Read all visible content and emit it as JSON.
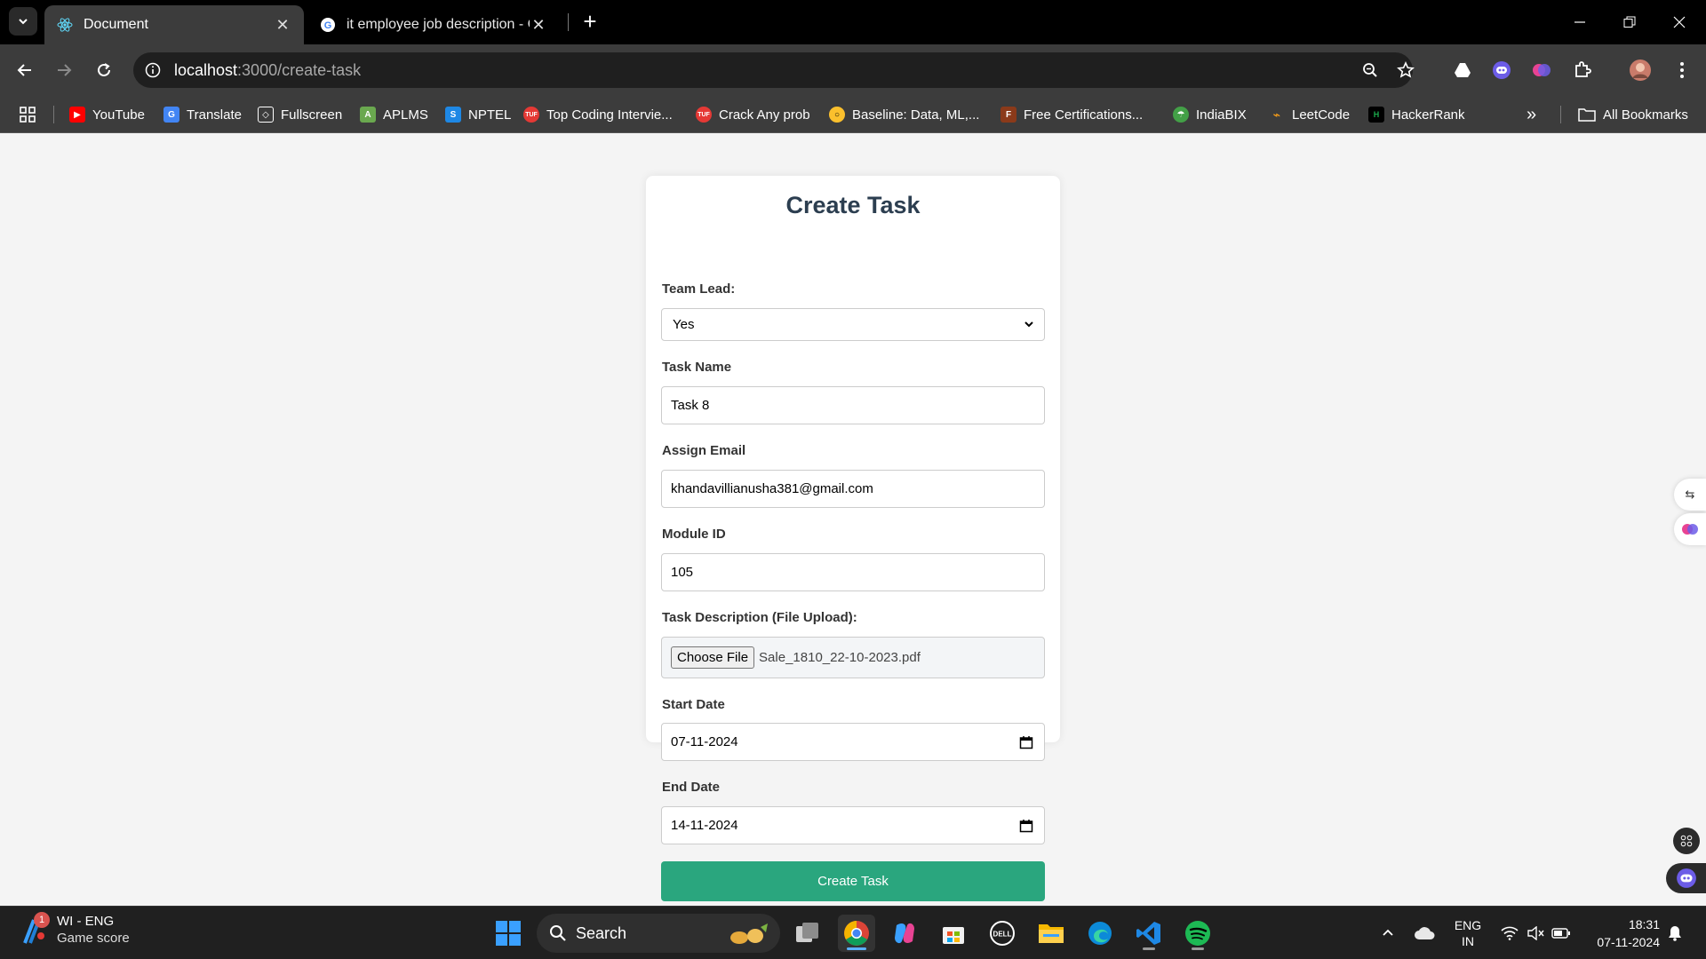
{
  "browser": {
    "tabs": [
      {
        "title": "Document",
        "active": true
      },
      {
        "title": "it employee job description - G",
        "active": false
      }
    ],
    "url_host": "localhost",
    "url_path": ":3000/create-task",
    "bookmarks": [
      {
        "label": "YouTube",
        "color": "#ff0000"
      },
      {
        "label": "Translate",
        "color": "#4285f4"
      },
      {
        "label": "Fullscreen",
        "color": "#ffffff"
      },
      {
        "label": "APLMS",
        "color": "#6aa84f"
      },
      {
        "label": "NPTEL",
        "color": "#1e88e5"
      },
      {
        "label": "Top Coding Intervie...",
        "color": "#e53935"
      },
      {
        "label": "Crack Any prob",
        "color": "#e53935"
      },
      {
        "label": "Baseline: Data, ML,...",
        "color": "#fbc02d"
      },
      {
        "label": "Free Certifications...",
        "color": "#8b3a1a"
      },
      {
        "label": "IndiaBIX",
        "color": "#43a047"
      },
      {
        "label": "LeetCode",
        "color": "#ffa116"
      },
      {
        "label": "HackerRank",
        "color": "#1ba94c"
      }
    ],
    "all_bookmarks": "All Bookmarks"
  },
  "form": {
    "title": "Create Task",
    "team_lead_label": "Team Lead:",
    "team_lead_value": "Yes",
    "task_name_label": "Task Name",
    "task_name_value": "Task 8",
    "assign_email_label": "Assign Email",
    "assign_email_value": "khandavillianusha381@gmail.com",
    "module_id_label": "Module ID",
    "module_id_value": "105",
    "task_desc_label": "Task Description (File Upload):",
    "choose_file_label": "Choose File",
    "file_name": "Sale_1810_22-10-2023.pdf",
    "start_date_label": "Start Date",
    "start_date_value": "07-11-2024",
    "end_date_label": "End Date",
    "end_date_value": "14-11-2024",
    "submit_label": "Create Task",
    "accent_color": "#2aa67e"
  },
  "taskbar": {
    "widget_title": "WI - ENG",
    "widget_subtitle": "Game score",
    "widget_badge": "1",
    "search_label": "Search",
    "lang_top": "ENG",
    "lang_bottom": "IN",
    "time": "18:31",
    "date": "07-11-2024"
  }
}
